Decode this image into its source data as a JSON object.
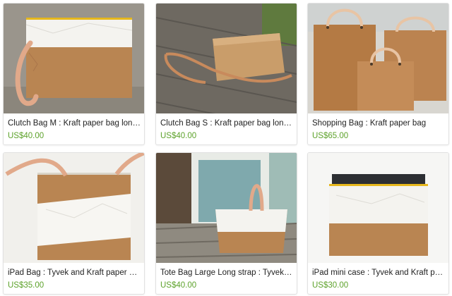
{
  "colors": {
    "price": "#5da22b",
    "title": "#222222",
    "kraft": "#b98552",
    "tyvek": "#f4f3ef",
    "leather": "#e1a98a",
    "zipper": "#e7b81c"
  },
  "products": [
    {
      "title": "Clutch Bag M : Kraft paper bag long strap : Tyvek and Kraft paper",
      "price": "US$40.00",
      "image": "clutch-bag-m-photo"
    },
    {
      "title": "Clutch Bag S : Kraft paper bag long strap",
      "price": "US$40.00",
      "image": "clutch-bag-s-photo"
    },
    {
      "title": "Shopping Bag : Kraft paper bag",
      "price": "US$65.00",
      "image": "shopping-bag-photo"
    },
    {
      "title": "iPad Bag : Tyvek and Kraft paper bag",
      "price": "US$35.00",
      "image": "ipad-bag-photo"
    },
    {
      "title": "Tote Bag Large Long strap : Tyvek and Kraft paper",
      "price": "US$40.00",
      "image": "tote-bag-photo"
    },
    {
      "title": "iPad mini case : Tyvek and Kraft paper case",
      "price": "US$30.00",
      "image": "ipad-mini-case-photo"
    }
  ]
}
